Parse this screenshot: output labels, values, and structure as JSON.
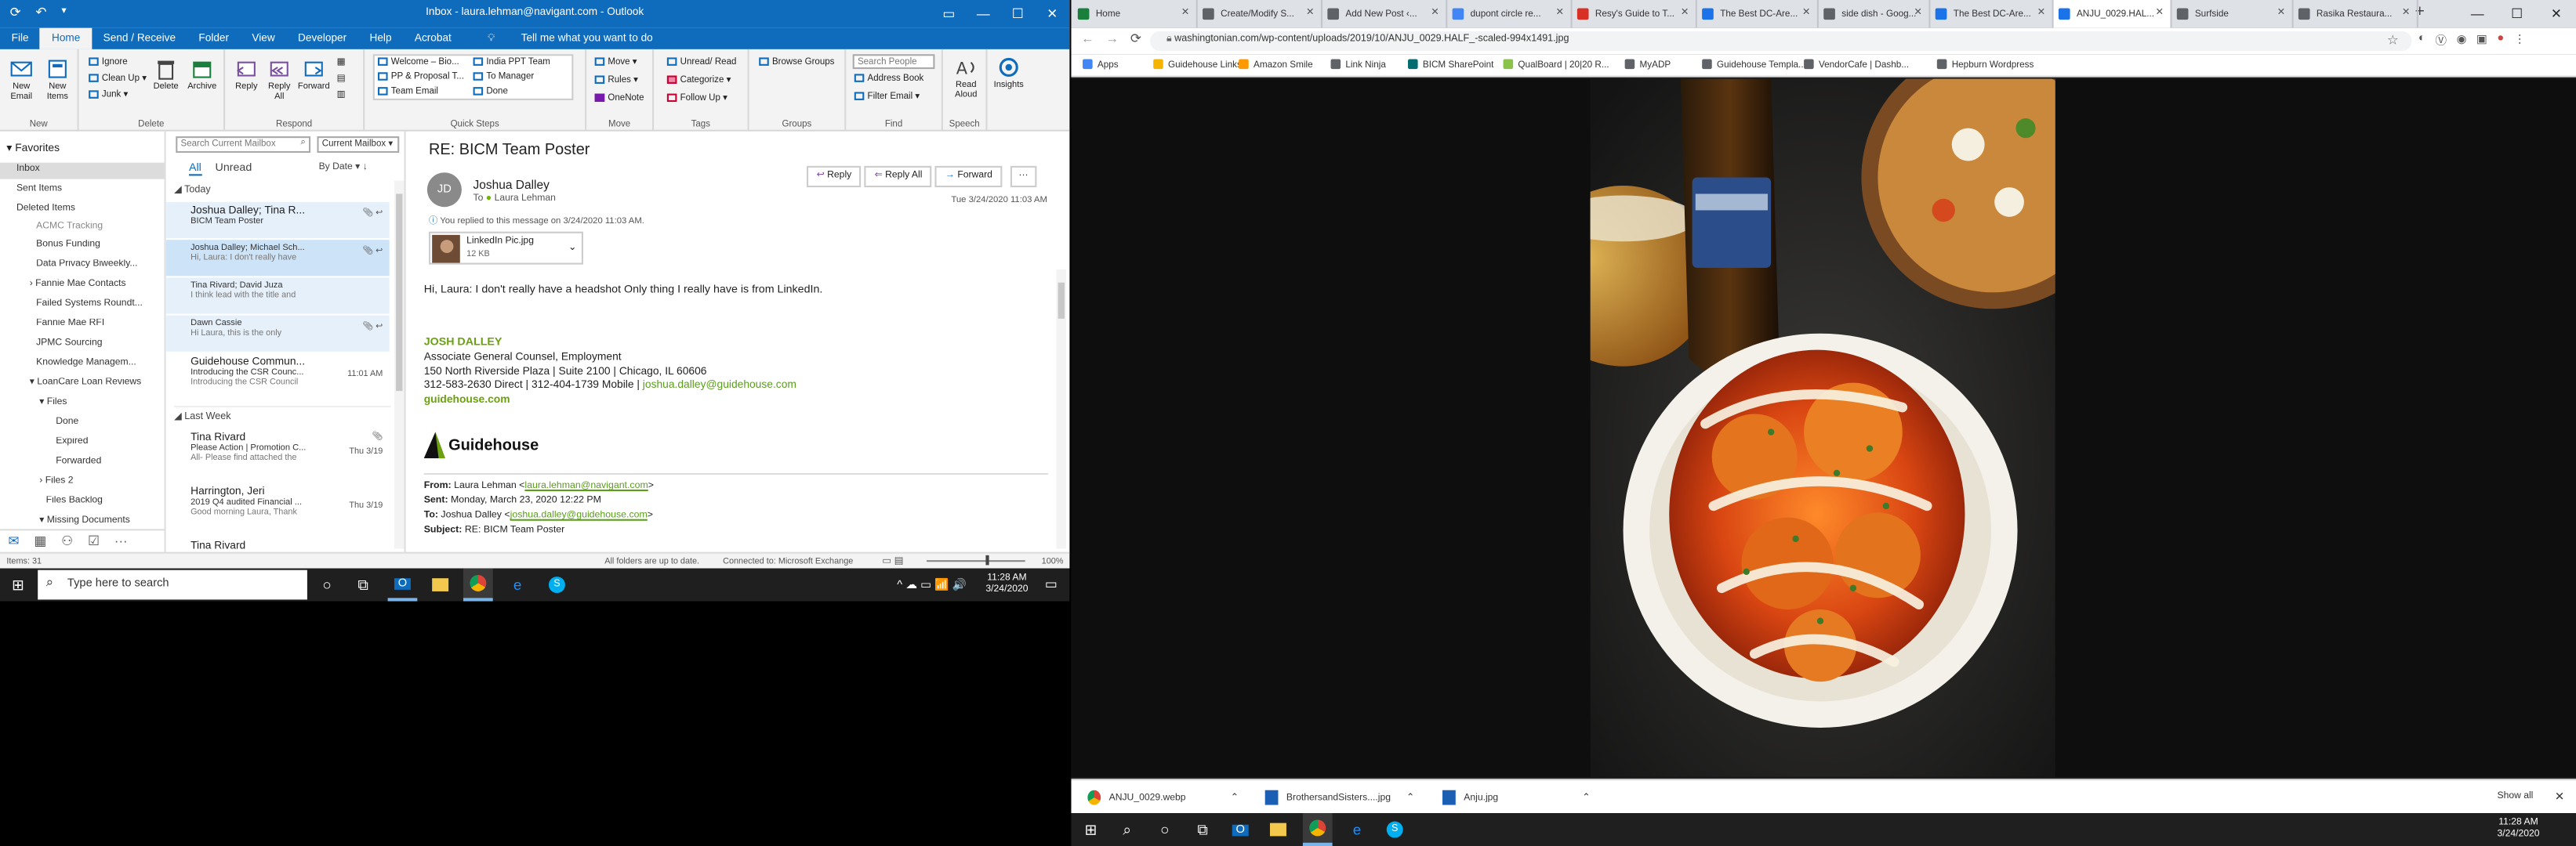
{
  "outlook": {
    "window_title": "Inbox - laura.lehman@navigant.com - Outlook",
    "menu_tabs": [
      "File",
      "Home",
      "Send / Receive",
      "Folder",
      "View",
      "Developer",
      "Help",
      "Acrobat"
    ],
    "tell_me": "Tell me what you want to do",
    "ribbon": {
      "new_email": "New Email",
      "new_items": "New Items",
      "ignore": "Ignore",
      "clean_up": "Clean Up",
      "junk": "Junk",
      "delete": "Delete",
      "archive": "Archive",
      "reply": "Reply",
      "reply_all": "Reply All",
      "forward": "Forward",
      "quick_steps": [
        "Welcome – Bio...",
        "PP & Proposal T...",
        "Team Email",
        "India PPT Team",
        "To Manager",
        "Done"
      ],
      "move": "Move",
      "rules": "Rules",
      "onenote": "OneNote",
      "unread_read": "Unread/ Read",
      "categorize": "Categorize",
      "follow_up": "Follow Up",
      "browse_groups": "Browse Groups",
      "search_people": "Search People",
      "address_book": "Address Book",
      "filter_email": "Filter Email",
      "read_aloud": "Read Aloud",
      "insights": "Insights",
      "groups": [
        "New",
        "Delete",
        "Respond",
        "Quick Steps",
        "Move",
        "Tags",
        "Groups",
        "Find",
        "Speech"
      ]
    },
    "folders": {
      "favorites": "Favorites",
      "favorite_items": [
        "Inbox",
        "Sent Items",
        "Deleted Items"
      ],
      "tree": [
        "ACMC Tracking",
        "Bonus Funding",
        "Data Privacy Biweekly...",
        "Fannie Mae Contacts",
        "Failed Systems Roundt...",
        "Fannie Mae RFI",
        "JPMC Sourcing",
        "Knowledge Managem...",
        "LoanCare Loan Reviews",
        "Files",
        "Done",
        "Expired",
        "Forwarded",
        "Files 2",
        "Files Backlog",
        "Missing Documents"
      ]
    },
    "list": {
      "search_placeholder": "Search Current Mailbox",
      "scope": "Current Mailbox",
      "filter_all": "All",
      "filter_unread": "Unread",
      "sort": "By Date",
      "group_today": "Today",
      "group_last_week": "Last Week",
      "messages": [
        {
          "from": "Joshua Dalley;  Tina R...",
          "subject": "BICM Team Poster",
          "preview": "",
          "date": ""
        },
        {
          "from": "Joshua Dalley;  Michael Sch...",
          "subject": "",
          "preview": "Hi, Laura:  I don't really have",
          "date": ""
        },
        {
          "from": "Tina Rivard;  David Juza",
          "subject": "",
          "preview": "I think lead with the title and",
          "date": ""
        },
        {
          "from": "Dawn Cassie",
          "subject": "",
          "preview": "Hi Laura, this is the only",
          "date": ""
        },
        {
          "from": "Guidehouse Commun...",
          "subject": "Introducing the CSR Counc...",
          "preview": "Introducing the CSR Council",
          "date": "11:01 AM"
        },
        {
          "from": "Tina Rivard",
          "subject": "Please Action | Promotion C...",
          "preview": "All-  Please find attached the",
          "date": "Thu 3/19"
        },
        {
          "from": "Harrington, Jeri",
          "subject": "2019 Q4 audited Financial ...",
          "preview": "Good morning Laura,  Thank",
          "date": "Thu 3/19"
        },
        {
          "from": "Tina Rivard",
          "subject": "",
          "preview": "",
          "date": ""
        }
      ]
    },
    "reading": {
      "subject": "RE: BICM Team Poster",
      "sender": "Joshua Dalley",
      "initials": "JD",
      "to_label": "To",
      "to": "Laura Lehman",
      "reply": "Reply",
      "reply_all": "Reply All",
      "forward": "Forward",
      "date": "Tue 3/24/2020 11:03 AM",
      "info": "You replied to this message on 3/24/2020 11:03 AM.",
      "attachment_name": "LinkedIn Pic.jpg",
      "attachment_size": "12 KB",
      "body_line": "Hi, Laura:  I don't really have a headshot  Only thing I really have is from LinkedIn.",
      "sig_name": "JOSH DALLEY",
      "sig_title": "Associate General Counsel, Employment",
      "sig_address": "150 North Riverside Plaza | Suite 2100 | Chicago, IL 60606",
      "sig_phone": "312-583-2630 Direct | 312-404-1739 Mobile | ",
      "sig_email": "joshua.dalley@guidehouse.com",
      "sig_web": "guidehouse.com",
      "logo_text": "Guidehouse",
      "from_label": "From:",
      "from_value": "Laura Lehman <",
      "from_email": "laura.lehman@navigant.com",
      "from_close": ">",
      "sent_label": "Sent:",
      "sent_value": "Monday, March 23, 2020 12:22 PM",
      "to2_label": "To:",
      "to2_value": "Joshua Dalley <",
      "to2_email": "joshua.dalley@guidehouse.com",
      "to2_close": ">",
      "subj_label": "Subject:",
      "subj_value": "RE: BICM Team Poster"
    },
    "status": {
      "items": "Items: 31",
      "all_folders": "All folders are up to date.",
      "connected": "Connected to: Microsoft Exchange",
      "zoom": "100%"
    }
  },
  "taskbar_left": {
    "search": "Type here to search",
    "time": "11:28 AM",
    "date": "3/24/2020"
  },
  "chrome": {
    "tabs": [
      {
        "title": "Home",
        "color": "#1a7f3c"
      },
      {
        "title": "Create/Modify S...",
        "color": "#5f6368"
      },
      {
        "title": "Add New Post ‹...",
        "color": "#5f6368"
      },
      {
        "title": "dupont circle re...",
        "color": "#4285f4"
      },
      {
        "title": "Resy's Guide to T...",
        "color": "#d93025"
      },
      {
        "title": "The Best DC-Are...",
        "color": "#1a73e8"
      },
      {
        "title": "side dish - Goog...",
        "color": "#5f6368"
      },
      {
        "title": "The Best DC-Are...",
        "color": "#1a73e8"
      },
      {
        "title": "ANJU_0029.HAL...",
        "color": "#1a73e8"
      },
      {
        "title": "Surfside",
        "color": "#5f6368"
      },
      {
        "title": "Rasika Restaura...",
        "color": "#5f6368"
      }
    ],
    "url": "washingtonian.com/wp-content/uploads/2019/10/ANJU_0029.HALF_-scaled-994x1491.jpg",
    "bookmarks": [
      {
        "label": "Apps",
        "color": "#4285f4"
      },
      {
        "label": "Guidehouse Links",
        "color": "#f4b400"
      },
      {
        "label": "Amazon Smile",
        "color": "#ff9900"
      },
      {
        "label": "Link Ninja",
        "color": "#5f6368"
      },
      {
        "label": "BICM SharePoint",
        "color": "#036c70"
      },
      {
        "label": "QualBoard | 20|20 R...",
        "color": "#8bc34a"
      },
      {
        "label": "MyADP",
        "color": "#5f6368"
      },
      {
        "label": "Guidehouse Templa...",
        "color": "#5f6368"
      },
      {
        "label": "VendorCafe | Dashb...",
        "color": "#5f6368"
      },
      {
        "label": "Hepburn Wordpress",
        "color": "#5f6368"
      }
    ],
    "downloads": [
      "ANJU_0029.webp",
      "BrothersandSisters....jpg",
      "Anju.jpg"
    ],
    "show_all": "Show all"
  },
  "taskbar_right": {
    "time": "11:28 AM",
    "date": "3/24/2020"
  },
  "colors": {
    "outlook_blue": "#0f6cbd",
    "signature_green": "#6aa10d",
    "link_green": "#5a9e1c",
    "taskbar": "#1f1f1f"
  }
}
